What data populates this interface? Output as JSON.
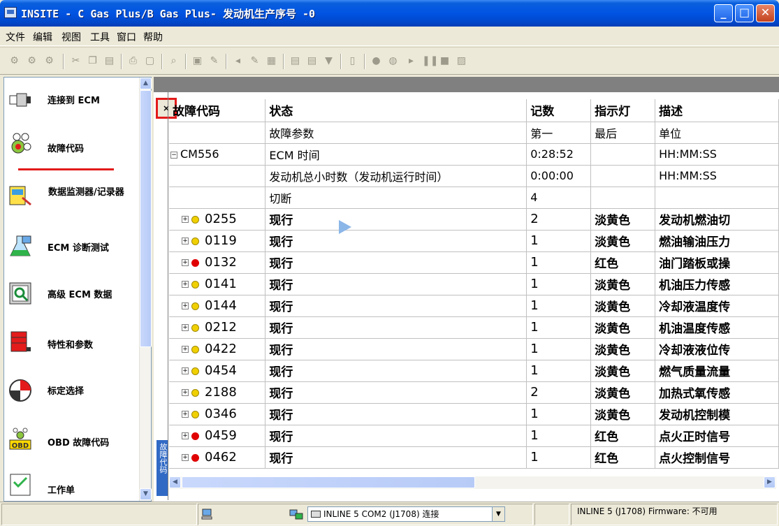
{
  "window": {
    "title": "INSITE - C Gas Plus/B Gas Plus- 发动机生产序号 -0",
    "minimize": "_",
    "maximize": "□",
    "close": "✕"
  },
  "menu": [
    "文件",
    "编辑",
    "视图",
    "工具",
    "窗口",
    "帮助"
  ],
  "sidebar": {
    "items": [
      {
        "label": "连接到 ECM",
        "icon": "connector-icon"
      },
      {
        "label": "故障代码",
        "icon": "fault-codes-icon"
      },
      {
        "label": "数据监测器/记录器",
        "icon": "data-monitor-icon"
      },
      {
        "label": "ECM 诊断测试",
        "icon": "flask-icon"
      },
      {
        "label": "高级 ECM 数据",
        "icon": "advanced-data-icon"
      },
      {
        "label": "特性和参数",
        "icon": "toolbox-icon"
      },
      {
        "label": "标定选择",
        "icon": "calibration-icon"
      },
      {
        "label": "OBD 故障代码",
        "icon": "obd-icon"
      },
      {
        "label": "工作单",
        "icon": "worksheet-icon"
      }
    ]
  },
  "panel": {
    "close_label": "×",
    "tab_label": "故障代码"
  },
  "table": {
    "headers": [
      "故障代码",
      "状态",
      "记数",
      "指示灯",
      "描述"
    ],
    "subheaders": [
      "",
      "故障参数",
      "第一",
      "最后",
      "单位"
    ],
    "group": {
      "code": "CM556"
    },
    "params": [
      {
        "name": "ECM 时间",
        "first": "0:28:52",
        "last": "",
        "unit": "HH:MM:SS"
      },
      {
        "name": "发动机总小时数（发动机运行时间）",
        "first": "0:00:00",
        "last": "",
        "unit": "HH:MM:SS"
      },
      {
        "name": "切断",
        "first": "4",
        "last": "",
        "unit": ""
      }
    ],
    "rows": [
      {
        "code": "0255",
        "status": "现行",
        "count": "2",
        "lamp": "淡黄色",
        "desc": "发动机燃油切",
        "color": "#f0d000"
      },
      {
        "code": "0119",
        "status": "现行",
        "count": "1",
        "lamp": "淡黄色",
        "desc": "燃油输油压力",
        "color": "#f0d000"
      },
      {
        "code": "0132",
        "status": "现行",
        "count": "1",
        "lamp": "红色",
        "desc": "油门踏板或操",
        "color": "#e00000"
      },
      {
        "code": "0141",
        "status": "现行",
        "count": "1",
        "lamp": "淡黄色",
        "desc": "机油压力传感",
        "color": "#f0d000"
      },
      {
        "code": "0144",
        "status": "现行",
        "count": "1",
        "lamp": "淡黄色",
        "desc": "冷却液温度传",
        "color": "#f0d000"
      },
      {
        "code": "0212",
        "status": "现行",
        "count": "1",
        "lamp": "淡黄色",
        "desc": "机油温度传感",
        "color": "#f0d000"
      },
      {
        "code": "0422",
        "status": "现行",
        "count": "1",
        "lamp": "淡黄色",
        "desc": "冷却液液位传",
        "color": "#f0d000"
      },
      {
        "code": "0454",
        "status": "现行",
        "count": "1",
        "lamp": "淡黄色",
        "desc": "燃气质量流量",
        "color": "#f0d000"
      },
      {
        "code": "2188",
        "status": "现行",
        "count": "2",
        "lamp": "淡黄色",
        "desc": "加热式氧传感",
        "color": "#f0d000"
      },
      {
        "code": "0346",
        "status": "现行",
        "count": "1",
        "lamp": "淡黄色",
        "desc": "发动机控制模",
        "color": "#f0d000"
      },
      {
        "code": "0459",
        "status": "现行",
        "count": "1",
        "lamp": "红色",
        "desc": "点火正时信号",
        "color": "#e00000"
      },
      {
        "code": "0462",
        "status": "现行",
        "count": "1",
        "lamp": "红色",
        "desc": "点火控制信号",
        "color": "#e00000"
      }
    ]
  },
  "status": {
    "connection": "INLINE 5 COM2 (J1708) 连接",
    "firmware": "INLINE 5 (J1708)  Firmware: 不可用"
  }
}
